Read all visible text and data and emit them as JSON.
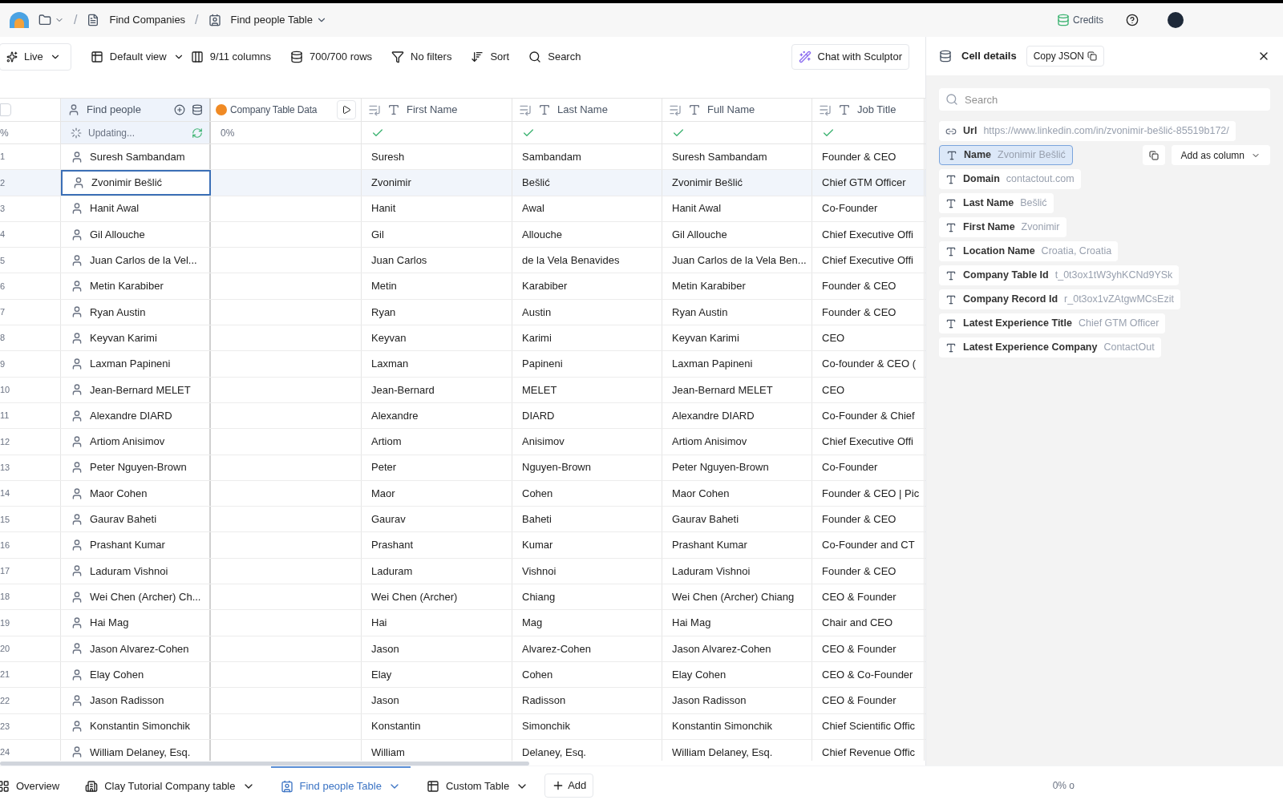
{
  "breadcrumb": [
    {
      "label": "Find Companies"
    },
    {
      "label": "Find people Table"
    }
  ],
  "breadcrumb_separator": "/",
  "top_right": {
    "credits": "Credits"
  },
  "toolbar": {
    "live": "Live",
    "view": "Default view",
    "columns": "9/11 columns",
    "rows": "700/700 rows",
    "filters": "No filters",
    "sort": "Sort",
    "search": "Search",
    "chat": "Chat with Sculptor"
  },
  "table": {
    "columns": [
      {
        "label": "Find people",
        "kind": "person"
      },
      {
        "label": "Company Table Data",
        "kind": "enrich"
      },
      {
        "label": "First Name",
        "kind": "text"
      },
      {
        "label": "Last Name",
        "kind": "text"
      },
      {
        "label": "Full Name",
        "kind": "text"
      },
      {
        "label": "Job Title",
        "kind": "text"
      }
    ],
    "select_all": {
      "checked": false
    },
    "status_row": {
      "number": "%",
      "updating": "Updating...",
      "progress": "0%"
    },
    "rows": [
      {
        "number": "1",
        "cells": [
          "Suresh Sambandam",
          "",
          "Suresh",
          "Sambandam",
          "Suresh Sambandam",
          "Founder & CEO"
        ],
        "selected": false
      },
      {
        "number": "2",
        "cells": [
          "Zvonimir Bešlić",
          "",
          "Zvonimir",
          "Bešlić",
          "Zvonimir Bešlić",
          "Chief GTM Officer"
        ],
        "selected": true
      },
      {
        "number": "3",
        "cells": [
          "Hanit Awal",
          "",
          "Hanit",
          "Awal",
          "Hanit Awal",
          "Co-Founder"
        ],
        "selected": false
      },
      {
        "number": "4",
        "cells": [
          "Gil Allouche",
          "",
          "Gil",
          "Allouche",
          "Gil Allouche",
          "Chief Executive Offi"
        ],
        "selected": false
      },
      {
        "number": "5",
        "cells": [
          "Juan Carlos de la Vel...",
          "",
          "Juan Carlos",
          "de la Vela Benavides",
          "Juan Carlos de la Vela Ben...",
          "Chief Executive Offi"
        ],
        "selected": false
      },
      {
        "number": "6",
        "cells": [
          "Metin Karabiber",
          "",
          "Metin",
          "Karabiber",
          "Metin Karabiber",
          "Founder & CEO"
        ],
        "selected": false
      },
      {
        "number": "7",
        "cells": [
          "Ryan Austin",
          "",
          "Ryan",
          "Austin",
          "Ryan Austin",
          "Founder & CEO"
        ],
        "selected": false
      },
      {
        "number": "8",
        "cells": [
          "Keyvan Karimi",
          "",
          "Keyvan",
          "Karimi",
          "Keyvan Karimi",
          "CEO"
        ],
        "selected": false
      },
      {
        "number": "9",
        "cells": [
          "Laxman Papineni",
          "",
          "Laxman",
          "Papineni",
          "Laxman Papineni",
          "Co-founder & CEO ("
        ],
        "selected": false
      },
      {
        "number": "10",
        "cells": [
          "Jean-Bernard MELET",
          "",
          "Jean-Bernard",
          "MELET",
          "Jean-Bernard MELET",
          "CEO"
        ],
        "selected": false
      },
      {
        "number": "11",
        "cells": [
          "Alexandre DIARD",
          "",
          "Alexandre",
          "DIARD",
          "Alexandre DIARD",
          "Co-Founder & Chief"
        ],
        "selected": false
      },
      {
        "number": "12",
        "cells": [
          "Artiom Anisimov",
          "",
          "Artiom",
          "Anisimov",
          "Artiom Anisimov",
          "Chief Executive Offi"
        ],
        "selected": false
      },
      {
        "number": "13",
        "cells": [
          "Peter Nguyen-Brown",
          "",
          "Peter",
          "Nguyen-Brown",
          "Peter Nguyen-Brown",
          "Co-Founder"
        ],
        "selected": false
      },
      {
        "number": "14",
        "cells": [
          "Maor Cohen",
          "",
          "Maor",
          "Cohen",
          "Maor Cohen",
          "Founder & CEO | Pic"
        ],
        "selected": false
      },
      {
        "number": "15",
        "cells": [
          "Gaurav Baheti",
          "",
          "Gaurav",
          "Baheti",
          "Gaurav Baheti",
          "Founder & CEO"
        ],
        "selected": false
      },
      {
        "number": "16",
        "cells": [
          "Prashant Kumar",
          "",
          "Prashant",
          "Kumar",
          "Prashant Kumar",
          "Co-Founder and CT"
        ],
        "selected": false
      },
      {
        "number": "17",
        "cells": [
          "Laduram Vishnoi",
          "",
          "Laduram",
          "Vishnoi",
          "Laduram Vishnoi",
          "Founder & CEO"
        ],
        "selected": false
      },
      {
        "number": "18",
        "cells": [
          "Wei Chen (Archer) Ch...",
          "",
          "Wei Chen (Archer)",
          "Chiang",
          "Wei Chen (Archer) Chiang",
          "CEO & Founder"
        ],
        "selected": false
      },
      {
        "number": "19",
        "cells": [
          "Hai Mag",
          "",
          "Hai",
          "Mag",
          "Hai Mag",
          "Chair and CEO"
        ],
        "selected": false
      },
      {
        "number": "20",
        "cells": [
          "Jason Alvarez-Cohen",
          "",
          "Jason",
          "Alvarez-Cohen",
          "Jason Alvarez-Cohen",
          "CEO & Founder"
        ],
        "selected": false
      },
      {
        "number": "21",
        "cells": [
          "Elay Cohen",
          "",
          "Elay",
          "Cohen",
          "Elay Cohen",
          "CEO & Co-Founder"
        ],
        "selected": false
      },
      {
        "number": "22",
        "cells": [
          "Jason Radisson",
          "",
          "Jason",
          "Radisson",
          "Jason Radisson",
          "CEO & Founder"
        ],
        "selected": false
      },
      {
        "number": "23",
        "cells": [
          "Konstantin Simonchik",
          "",
          "Konstantin",
          "Simonchik",
          "Konstantin Simonchik",
          "Chief Scientific Offic"
        ],
        "selected": false
      },
      {
        "number": "24",
        "cells": [
          "William Delaney, Esq.",
          "",
          "William",
          "Delaney, Esq.",
          "William Delaney, Esq.",
          "Chief Revenue Offic"
        ],
        "selected": false
      }
    ]
  },
  "panel": {
    "title": "Cell details",
    "copy": "Copy JSON",
    "search_placeholder": "Search",
    "add_column": "Add as column",
    "fields": [
      {
        "kind": "link",
        "label": "Url",
        "value": "https://www.linkedin.com/in/zvonimir-bešlić-85519b172/",
        "selected": false
      },
      {
        "kind": "text",
        "label": "Name",
        "value": "Zvonimir Bešlić",
        "selected": true
      },
      {
        "kind": "text",
        "label": "Domain",
        "value": "contactout.com",
        "selected": false
      },
      {
        "kind": "text",
        "label": "Last Name",
        "value": "Bešlić",
        "selected": false
      },
      {
        "kind": "text",
        "label": "First Name",
        "value": "Zvonimir",
        "selected": false
      },
      {
        "kind": "text",
        "label": "Location Name",
        "value": "Croatia, Croatia",
        "selected": false
      },
      {
        "kind": "text",
        "label": "Company Table Id",
        "value": "t_0t3ox1tW3yhKCNd9YSk",
        "selected": false
      },
      {
        "kind": "text",
        "label": "Company Record Id",
        "value": "r_0t3ox1vZAtgwMCsEzit",
        "selected": false
      },
      {
        "kind": "text",
        "label": "Latest Experience Title",
        "value": "Chief GTM Officer",
        "selected": false
      },
      {
        "kind": "text",
        "label": "Latest Experience Company",
        "value": "ContactOut",
        "selected": false
      }
    ]
  },
  "bottom_tabs": [
    {
      "label": "Overview",
      "selected": false
    },
    {
      "label": "Clay Tutorial Company table",
      "selected": false
    },
    {
      "label": "Find people Table",
      "selected": true
    },
    {
      "label": "Custom Table",
      "selected": false
    }
  ],
  "add_tab": "Add",
  "footer_status": "0% o"
}
